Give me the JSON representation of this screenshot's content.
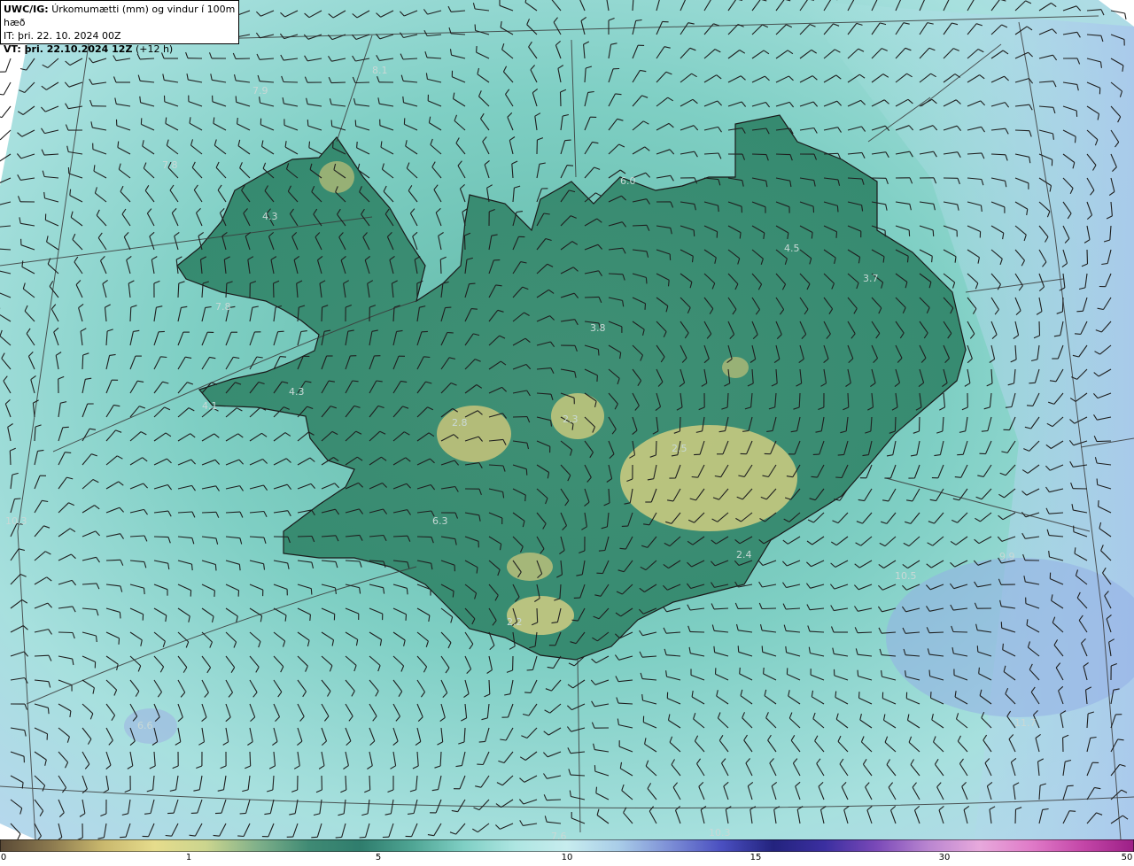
{
  "header": {
    "product_code": "UWC/IG:",
    "product_desc": "Úrkomumætti (mm) og vindur í 100m hæð",
    "init_time": "IT: þri. 22. 10. 2024 00Z",
    "valid_prefix": "VT: þri. 22.10.2024 12Z",
    "valid_offset": "(+12 h)"
  },
  "colorbar": {
    "ticks": [
      "0",
      "1",
      "5",
      "10",
      "15",
      "30",
      "50"
    ],
    "colors": [
      "#5a4a36",
      "#8c7a4f",
      "#c9b86d",
      "#e6dc8c",
      "#cbd58e",
      "#7fb08a",
      "#3f8a74",
      "#2f7d6d",
      "#4fa594",
      "#7fcfc4",
      "#aee6e2",
      "#c7ecee",
      "#a9cde8",
      "#7c8ed6",
      "#4a4fc0",
      "#23237e",
      "#3b2fa0",
      "#7a49b8",
      "#b985d0",
      "#e7a9dc",
      "#e07bc8",
      "#c447a8",
      "#9c1f86"
    ]
  },
  "labels": [
    {
      "text": "8.1"
    },
    {
      "text": "7.9"
    },
    {
      "text": "7.8"
    },
    {
      "text": "4.3"
    },
    {
      "text": "7.8"
    },
    {
      "text": "4.3"
    },
    {
      "text": "4.1"
    },
    {
      "text": "2.8"
    },
    {
      "text": "2.3"
    },
    {
      "text": "2.5"
    },
    {
      "text": "6.3"
    },
    {
      "text": "3.8"
    },
    {
      "text": "4.5"
    },
    {
      "text": "3.7"
    },
    {
      "text": "2.4"
    },
    {
      "text": "2.2"
    },
    {
      "text": "6.0"
    },
    {
      "text": "10.3"
    },
    {
      "text": "7.6"
    },
    {
      "text": "11.7"
    },
    {
      "text": "9.9"
    },
    {
      "text": "10.5"
    },
    {
      "text": "10.3"
    },
    {
      "text": "6.6"
    }
  ],
  "colors": {
    "land_outline": "#1a1a1a",
    "grid_line": "#3a3a3a",
    "barb": "#1f1f1f"
  }
}
